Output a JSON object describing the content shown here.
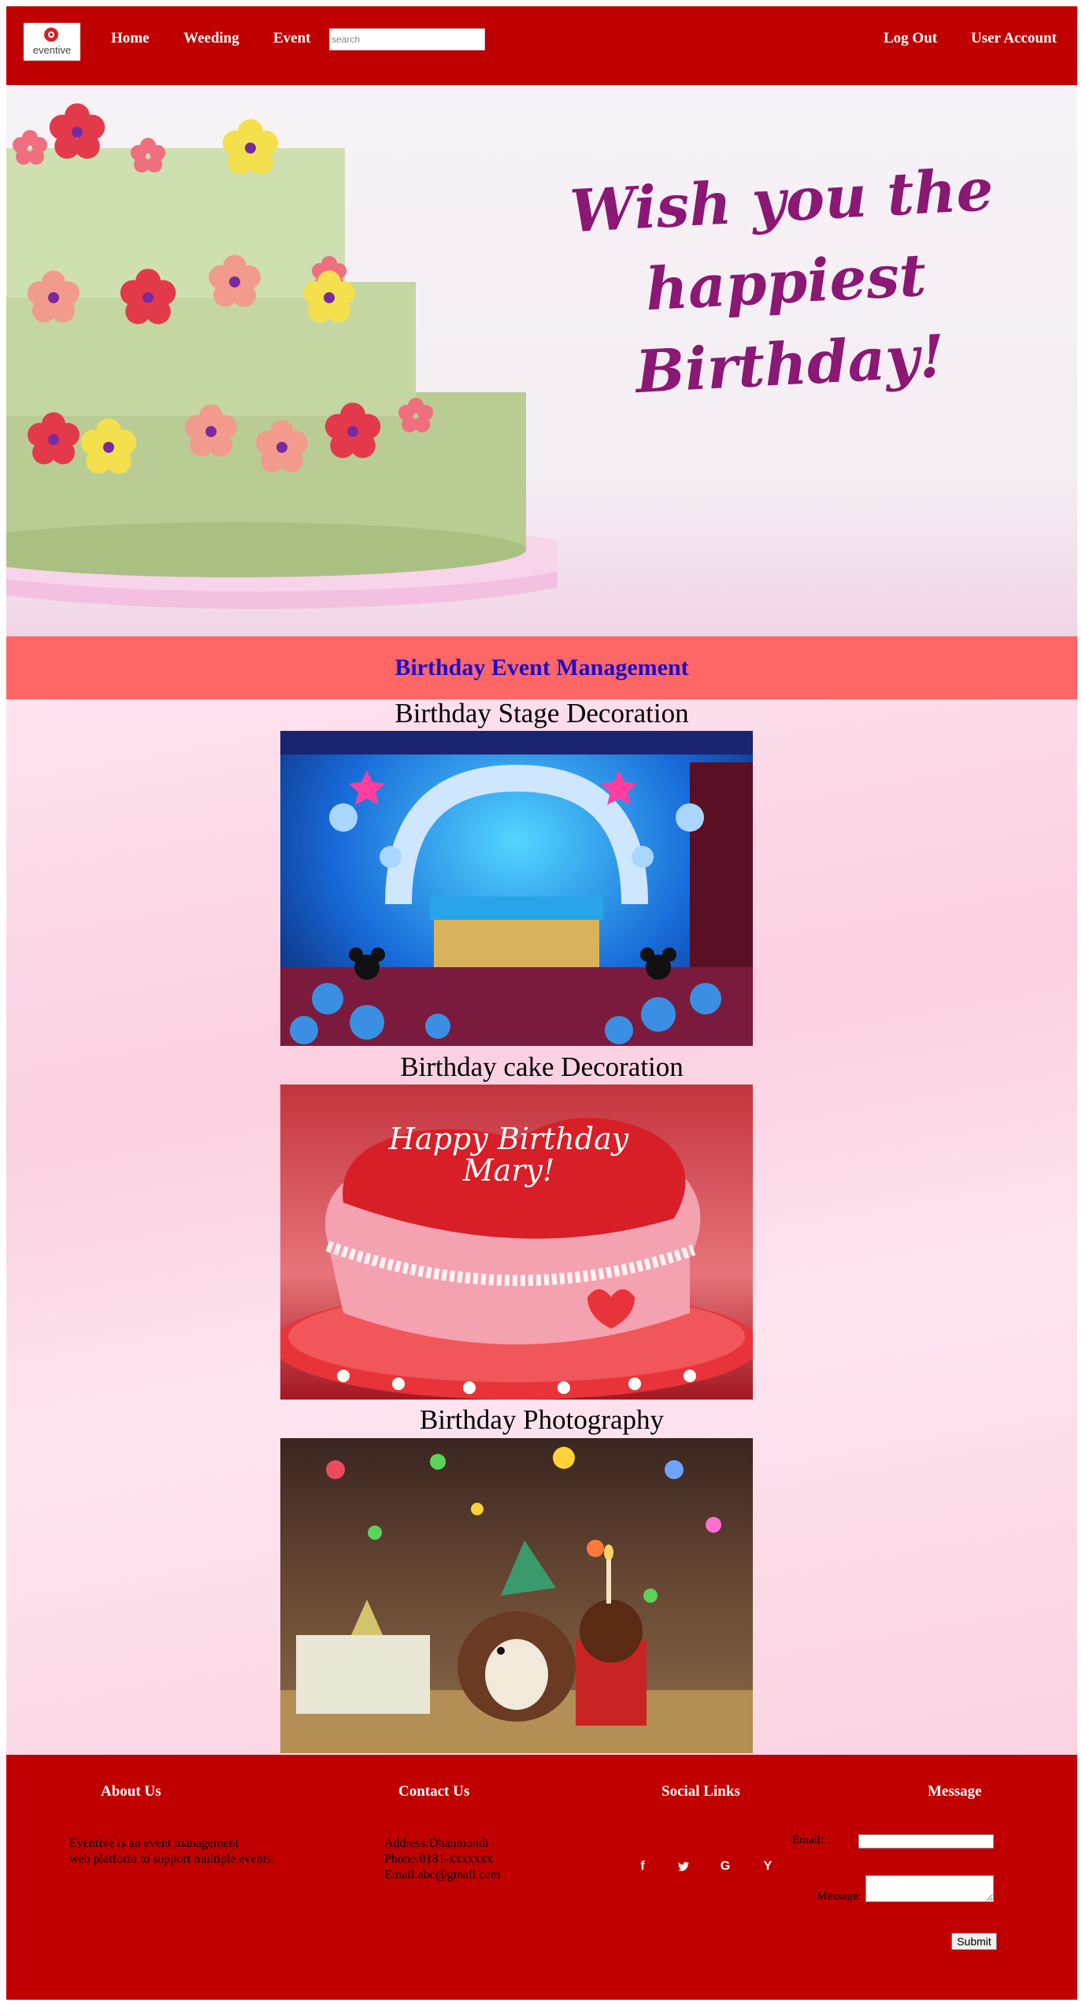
{
  "header": {
    "logo_text": "eventive",
    "nav": [
      "Home",
      "Weeding",
      "Event"
    ],
    "search_placeholder": "search",
    "right_links": [
      "Log Out",
      "User Account"
    ]
  },
  "hero": {
    "line1": "Wish you the",
    "line2": "happiest Birthday!"
  },
  "banner": {
    "title": "Birthday Event Management"
  },
  "sections": [
    {
      "title": "Birthday Stage Decoration"
    },
    {
      "title": "Birthday cake Decoration"
    },
    {
      "title": "Birthday Photography"
    }
  ],
  "footer": {
    "about": {
      "heading": "About Us",
      "line1": "Eventive is an event management",
      "line2": "web platform to support multiple events."
    },
    "contact": {
      "heading": "Contact Us",
      "address": "Address:Dhanmondi",
      "phone": "Phone:0181-xxxxxxx",
      "email": "Email:abc@gmail.com"
    },
    "social": {
      "heading": "Social Links",
      "icons": [
        "facebook-icon",
        "twitter-icon",
        "google-icon",
        "yahoo-icon"
      ]
    },
    "message": {
      "heading": "Message",
      "email_label": "Email:",
      "message_label": "Message:",
      "submit_label": "Submit"
    }
  },
  "colors": {
    "header_bg": "#c00000",
    "banner_bg": "#ff6666",
    "banner_text": "#1a0dcc",
    "hero_text": "#8a1874"
  }
}
